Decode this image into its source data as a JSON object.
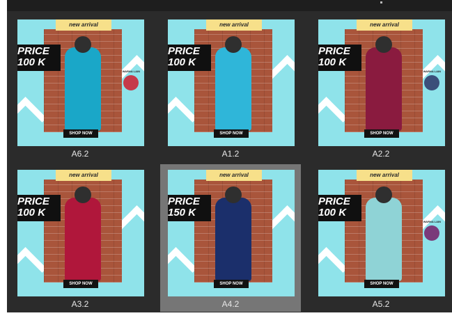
{
  "gallery": {
    "items": [
      {
        "caption": "A6.2",
        "banner": "new arrival",
        "price_line1": "PRICE",
        "price_line2": "100 K",
        "shop": "SHOP NOW",
        "swatch_label": "WARNA LAIN",
        "dress_color": "#1aa7c8",
        "swatch_color": "#c53a4a",
        "selected": false
      },
      {
        "caption": "A1.2",
        "banner": "new arrival",
        "price_line1": "PRICE",
        "price_line2": "100 K",
        "shop": "SHOP NOW",
        "swatch_label": "",
        "dress_color": "#2fb6d9",
        "swatch_color": "",
        "selected": false
      },
      {
        "caption": "A2.2",
        "banner": "new arrival",
        "price_line1": "PRICE",
        "price_line2": "100 K",
        "shop": "SHOP NOW",
        "swatch_label": "WARNA LAIN",
        "dress_color": "#8a1b3f",
        "swatch_color": "#3b4f7a",
        "selected": false
      },
      {
        "caption": "A3.2",
        "banner": "new arrival",
        "price_line1": "PRICE",
        "price_line2": "100 K",
        "shop": "SHOP NOW",
        "swatch_label": "",
        "dress_color": "#b0173b",
        "swatch_color": "",
        "selected": false
      },
      {
        "caption": "A4.2",
        "banner": "new arrival",
        "price_line1": "PRICE",
        "price_line2": "150 K",
        "shop": "SHOP NOW",
        "swatch_label": "",
        "dress_color": "#1b2f6b",
        "swatch_color": "",
        "selected": true
      },
      {
        "caption": "A5.2",
        "banner": "new arrival",
        "price_line1": "PRICE",
        "price_line2": "100 K",
        "shop": "SHOP NOW",
        "swatch_label": "WARNA LAIN",
        "dress_color": "#8fd3d6",
        "swatch_color": "#7a3a7a",
        "selected": false
      }
    ]
  }
}
